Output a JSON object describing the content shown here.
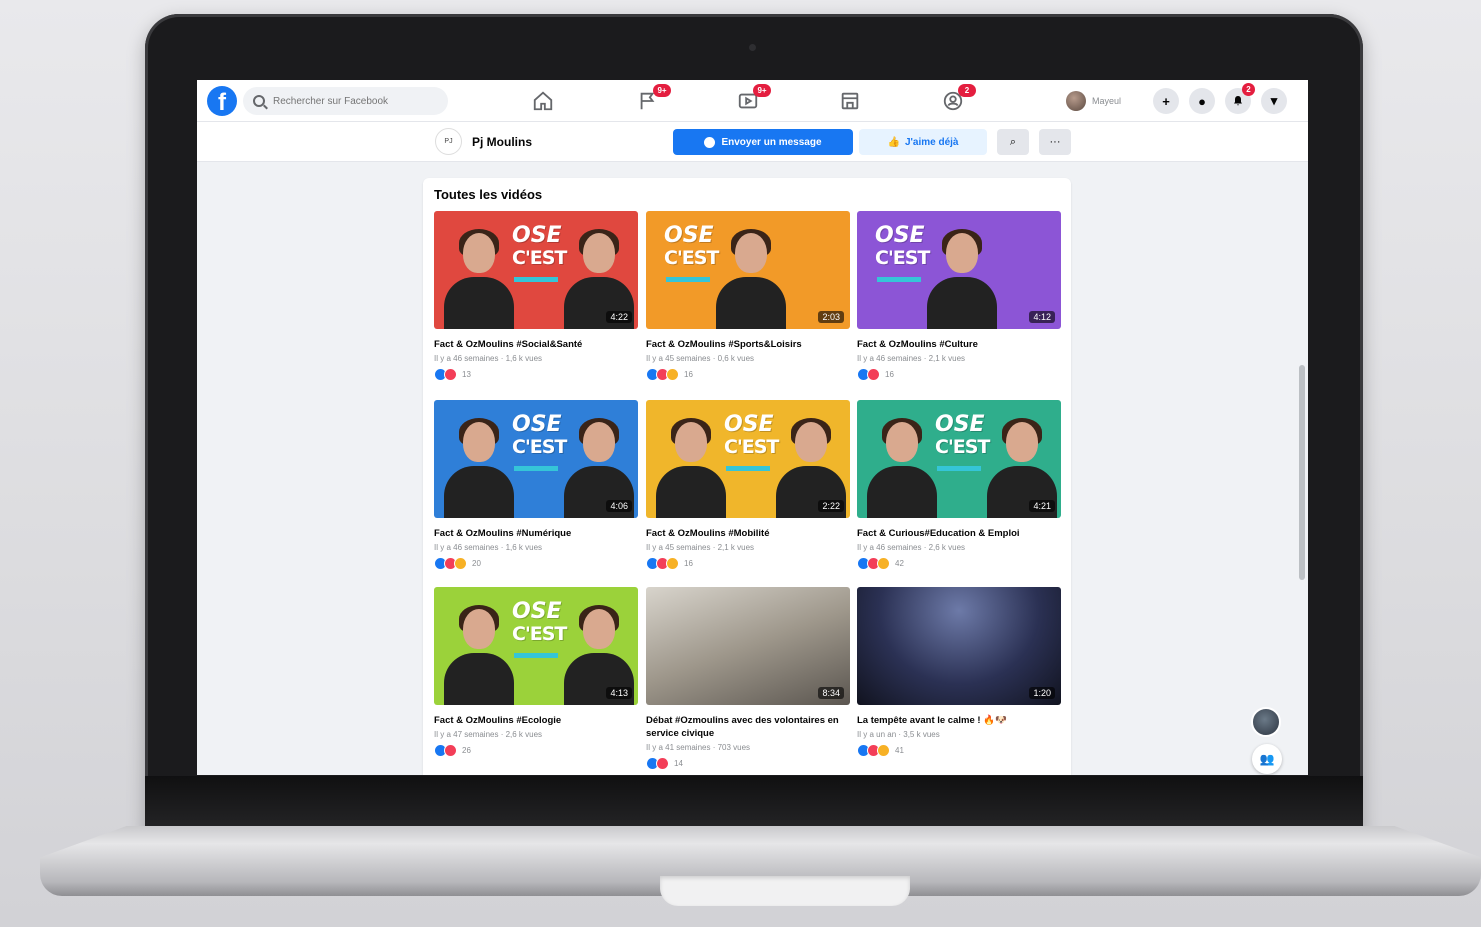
{
  "topbar": {
    "logo": "f",
    "search_placeholder": "Rechercher sur Facebook",
    "nav": [
      {
        "icon": "home-icon",
        "badge": ""
      },
      {
        "icon": "flag-icon",
        "badge": "9+"
      },
      {
        "icon": "watch-icon",
        "badge": "9+"
      },
      {
        "icon": "marketplace-icon",
        "badge": ""
      },
      {
        "icon": "groups-icon",
        "badge": "2"
      }
    ],
    "profile_name": "Mayeul",
    "buttons": {
      "create": "+",
      "messenger": "●",
      "notifications_badge": "2",
      "menu": "▾"
    }
  },
  "page": {
    "avatar_text": "PJ",
    "name": "Pj Moulins",
    "message_button": "Envoyer un message",
    "like_button": "J'aime déjà",
    "search_button": "⌕",
    "more_button": "···"
  },
  "videos": {
    "section_title": "Toutes les vidéos",
    "items": [
      {
        "title": "Fact & OzMoulins #Social&Santé",
        "meta": "Il y a 46 semaines · 1,6 k vues",
        "duration": "4:22",
        "reactions": [
          "like",
          "love"
        ],
        "count": "13",
        "bg": "#e0483f"
      },
      {
        "title": "Fact & OzMoulins #Sports&Loisirs",
        "meta": "Il y a 45 semaines · 0,6 k vues",
        "duration": "2:03",
        "reactions": [
          "like",
          "love",
          "haha"
        ],
        "count": "16",
        "bg": "#f29a28"
      },
      {
        "title": "Fact & OzMoulins #Culture",
        "meta": "Il y a 46 semaines · 2,1 k vues",
        "duration": "4:12",
        "reactions": [
          "like",
          "love"
        ],
        "count": "16",
        "bg": "#8c55d6"
      },
      {
        "title": "Fact & OzMoulins #Numérique",
        "meta": "Il y a 46 semaines · 1,6 k vues",
        "duration": "4:06",
        "reactions": [
          "like",
          "love",
          "haha"
        ],
        "count": "20",
        "bg": "#2f7fd8"
      },
      {
        "title": "Fact & OzMoulins #Mobilité",
        "meta": "Il y a 45 semaines · 2,1 k vues",
        "duration": "2:22",
        "reactions": [
          "like",
          "love",
          "haha"
        ],
        "count": "16",
        "bg": "#f0b62b"
      },
      {
        "title": "Fact & Curious#Education & Emploi",
        "meta": "Il y a 46 semaines · 2,6 k vues",
        "duration": "4:21",
        "reactions": [
          "like",
          "love",
          "haha"
        ],
        "count": "42",
        "bg": "#2fae8c"
      },
      {
        "title": "Fact & OzMoulins #Ecologie",
        "meta": "Il y a 47 semaines · 2,6 k vues",
        "duration": "4:13",
        "reactions": [
          "like",
          "love"
        ],
        "count": "26",
        "bg": "#9bd23a"
      },
      {
        "title": "Débat #Ozmoulins avec des volontaires en service civique",
        "meta": "Il y a 41 semaines · 703 vues",
        "duration": "8:34",
        "reactions": [
          "like",
          "love"
        ],
        "count": "14",
        "bg": "#b9b4ac"
      },
      {
        "title": "La tempête avant le calme ! 🔥🐶",
        "meta": "Il y a un an · 3,5 k vues",
        "duration": "1:20",
        "reactions": [
          "like",
          "love",
          "haha"
        ],
        "count": "41",
        "bg": "#2b3154"
      }
    ]
  }
}
